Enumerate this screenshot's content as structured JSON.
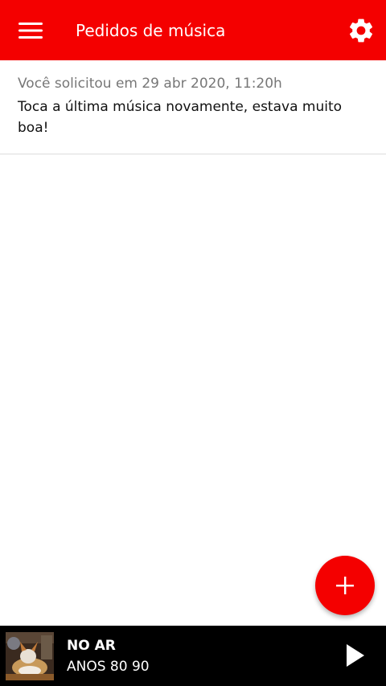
{
  "header": {
    "title": "Pedidos de música",
    "menu_icon": "hamburger-menu-icon",
    "settings_icon": "gear-icon"
  },
  "requests": [
    {
      "meta": "Você solicitou em 29 abr 2020, 11:20h",
      "text": "Toca a última música novamente, estava muito boa!"
    }
  ],
  "fab": {
    "icon": "plus-icon"
  },
  "player": {
    "status": "NO AR",
    "station": "ANOS 80 90",
    "play_icon": "play-icon"
  },
  "colors": {
    "accent": "#f40000",
    "player_background": "#000000",
    "meta_text": "#777777"
  }
}
